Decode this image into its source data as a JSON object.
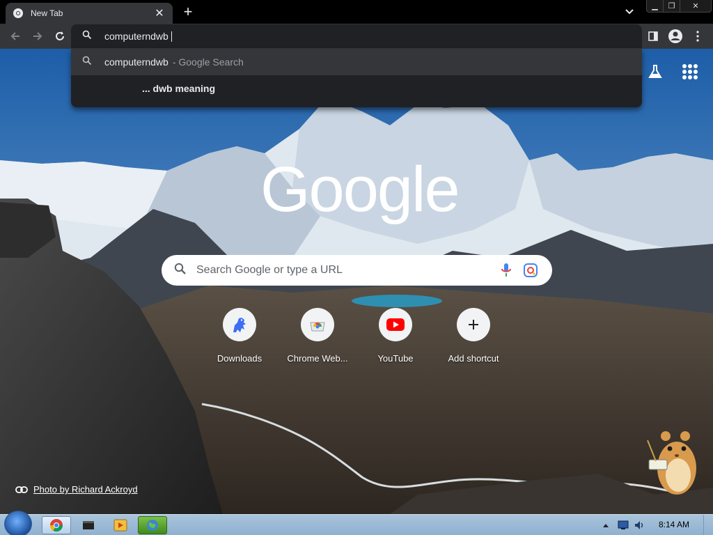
{
  "window": {
    "tab_title": "New Tab",
    "tab_close_icon": "close-icon",
    "new_tab_icon": "plus-icon"
  },
  "toolbar": {
    "back_icon": "arrow-left-icon",
    "forward_icon": "arrow-right-icon",
    "reload_icon": "reload-icon",
    "omnibox_text": "computerndwb",
    "sidepanel_icon": "side-panel-icon",
    "profile_icon": "profile-icon",
    "menu_icon": "kebab-menu-icon"
  },
  "dropdown": {
    "suggestion_1_text": "computerndwb",
    "suggestion_1_sep": "- Google Search",
    "suggestion_2_text": "... dwb meaning"
  },
  "ntp": {
    "logo_text": "Google",
    "search_placeholder": "Search Google or type a URL",
    "shortcuts": [
      {
        "label": "Downloads",
        "icon": "downloads-dino-icon"
      },
      {
        "label": "Chrome Web...",
        "icon": "chrome-web-store-icon"
      },
      {
        "label": "YouTube",
        "icon": "youtube-icon"
      },
      {
        "label": "Add shortcut",
        "icon": "plus-icon"
      }
    ],
    "photo_credit": "Photo by Richard Ackroyd"
  },
  "taskbar": {
    "time": "8:14 AM",
    "items": [
      "chrome-icon",
      "terminal-icon",
      "media-player-icon",
      "globe-app-icon"
    ]
  },
  "colors": {
    "toolbar": "#35363a",
    "omnibox": "#202124",
    "accent_text": "#e8eaed",
    "youtube_red": "#ff0000"
  }
}
